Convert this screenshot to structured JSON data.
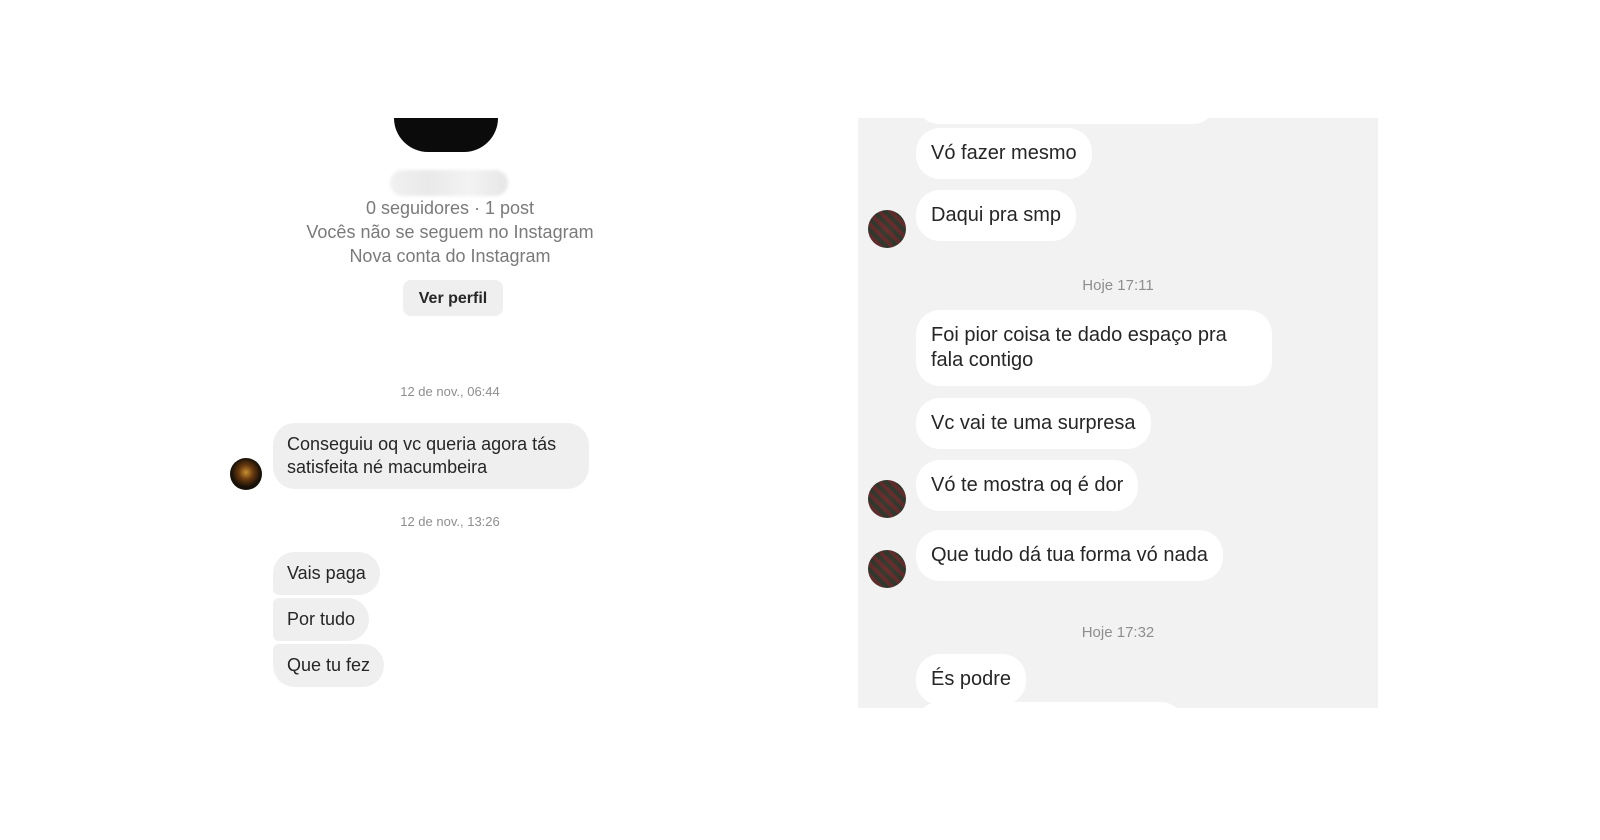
{
  "left": {
    "profile": {
      "followers_posts": "0 seguidores · 1 post",
      "follow_status": "Vocês não se seguem no Instagram",
      "account_note": "Nova conta do Instagram",
      "view_profile_label": "Ver perfil"
    },
    "timestamps": [
      "12 de nov., 06:44",
      "12 de nov., 13:26"
    ],
    "messages": [
      "Conseguiu oq vc queria agora tás satisfeita né macumbeira",
      "Vais paga",
      "Por tudo",
      "Que tu fez"
    ]
  },
  "right": {
    "timestamps": [
      "Hoje 17:11",
      "Hoje 17:32"
    ],
    "messages": [
      "Vó fazer mesmo",
      "Daqui pra smp",
      "Foi pior coisa te dado espaço pra fala contigo",
      "Vc vai te uma surpresa",
      "Vó te mostra oq é dor",
      "Que tudo dá tua forma vó nada",
      "És podre"
    ]
  }
}
